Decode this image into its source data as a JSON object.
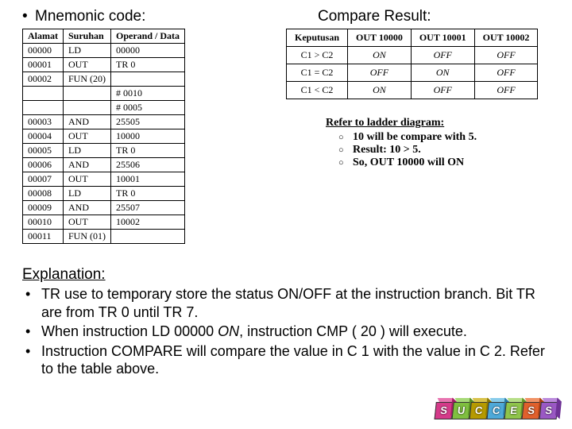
{
  "headings": {
    "mnemonic": "Mnemonic code:",
    "compare": "Compare Result:",
    "explanation": "Explanation:"
  },
  "mn_table": {
    "head": {
      "c0": "Alamat",
      "c1": "Suruhan",
      "c2": "Operand / Data"
    },
    "rows": [
      {
        "c0": "00000",
        "c1": "LD",
        "c2": "00000"
      },
      {
        "c0": "00001",
        "c1": "OUT",
        "c2": "TR 0"
      },
      {
        "c0": "00002",
        "c1": "FUN (20)",
        "c2": ""
      },
      {
        "c0": "",
        "c1": "",
        "c2": "# 0010"
      },
      {
        "c0": "",
        "c1": "",
        "c2": "# 0005"
      },
      {
        "c0": "00003",
        "c1": "AND",
        "c2": "25505"
      },
      {
        "c0": "00004",
        "c1": "OUT",
        "c2": "10000"
      },
      {
        "c0": "00005",
        "c1": "LD",
        "c2": "TR 0"
      },
      {
        "c0": "00006",
        "c1": "AND",
        "c2": "25506"
      },
      {
        "c0": "00007",
        "c1": "OUT",
        "c2": "10001"
      },
      {
        "c0": "00008",
        "c1": "LD",
        "c2": "TR 0"
      },
      {
        "c0": "00009",
        "c1": "AND",
        "c2": "25507"
      },
      {
        "c0": "00010",
        "c1": "OUT",
        "c2": "10002"
      },
      {
        "c0": "00011",
        "c1": "FUN (01)",
        "c2": ""
      }
    ]
  },
  "cmp_table": {
    "head": {
      "c0": "Keputusan",
      "c1": "OUT 10000",
      "c2": "OUT 10001",
      "c3": "OUT 10002"
    },
    "rows": [
      {
        "c0": "C1 > C2",
        "c1": "ON",
        "c2": "OFF",
        "c3": "OFF"
      },
      {
        "c0": "C1 = C2",
        "c1": "OFF",
        "c2": "ON",
        "c3": "OFF"
      },
      {
        "c0": "C1 < C2",
        "c1": "ON",
        "c2": "OFF",
        "c3": "OFF"
      }
    ]
  },
  "refer": {
    "title": "Refer to ladder diagram:",
    "items": [
      "10 will be compare with 5.",
      "Result: 10 > 5.",
      "So, OUT 10000 will ON"
    ]
  },
  "explanation": {
    "items": [
      {
        "pre": "TR use to temporary store the status ON/OFF at the instruction branch. Bit TR are from TR 0 until TR 7."
      },
      {
        "pre": "When instruction LD 00000 ",
        "em": "ON",
        "post": ", instruction CMP ( 20 ) will execute."
      },
      {
        "pre": "Instruction COMPARE will compare the value in C 1 with the value in C 2. Refer to the table above."
      }
    ]
  },
  "cubes": [
    {
      "letter": "S",
      "front": "#d53a8a",
      "top": "#e874b0",
      "side": "#a31d64"
    },
    {
      "letter": "U",
      "front": "#7fbf3f",
      "top": "#a6d977",
      "side": "#568c22"
    },
    {
      "letter": "C",
      "front": "#b69a00",
      "top": "#d8c24a",
      "side": "#8c7700"
    },
    {
      "letter": "C",
      "front": "#4ea9d9",
      "top": "#87cbea",
      "side": "#2a7aa6"
    },
    {
      "letter": "E",
      "front": "#8fc44b",
      "top": "#b6de87",
      "side": "#639428"
    },
    {
      "letter": "S",
      "front": "#e0602c",
      "top": "#f19265",
      "side": "#a83f14"
    },
    {
      "letter": "S",
      "front": "#9a58c4",
      "top": "#bb8adc",
      "side": "#6f3396"
    }
  ]
}
